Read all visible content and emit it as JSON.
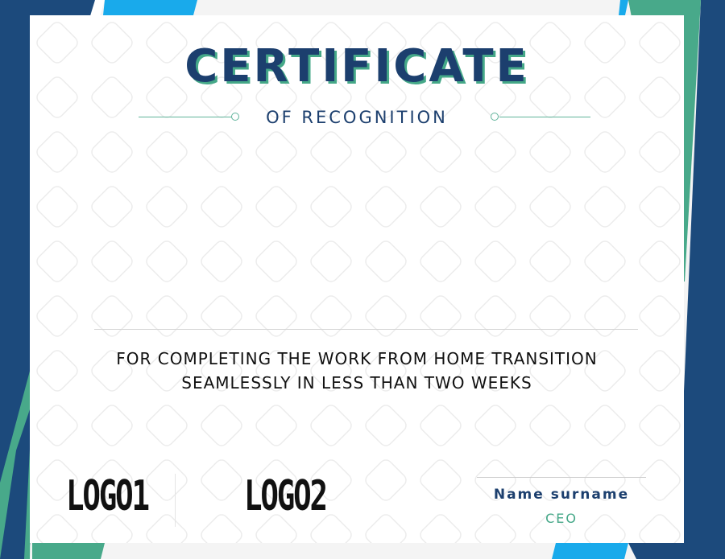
{
  "certificate": {
    "title": "CERTIFICATE",
    "subtitle": "OF RECOGNITION",
    "message_line1": "FOR COMPLETING THE WORK FROM HOME TRANSITION",
    "message_line2": "SEAMLESSLY IN LESS THAN TWO WEEKS"
  },
  "logos": [
    "LOGO1",
    "LOGO2"
  ],
  "signature": {
    "name": "Name surname",
    "role": "CEO"
  },
  "colors": {
    "navy": "#1c3f6e",
    "teal": "#45a888",
    "sky": "#1aa7e8"
  }
}
